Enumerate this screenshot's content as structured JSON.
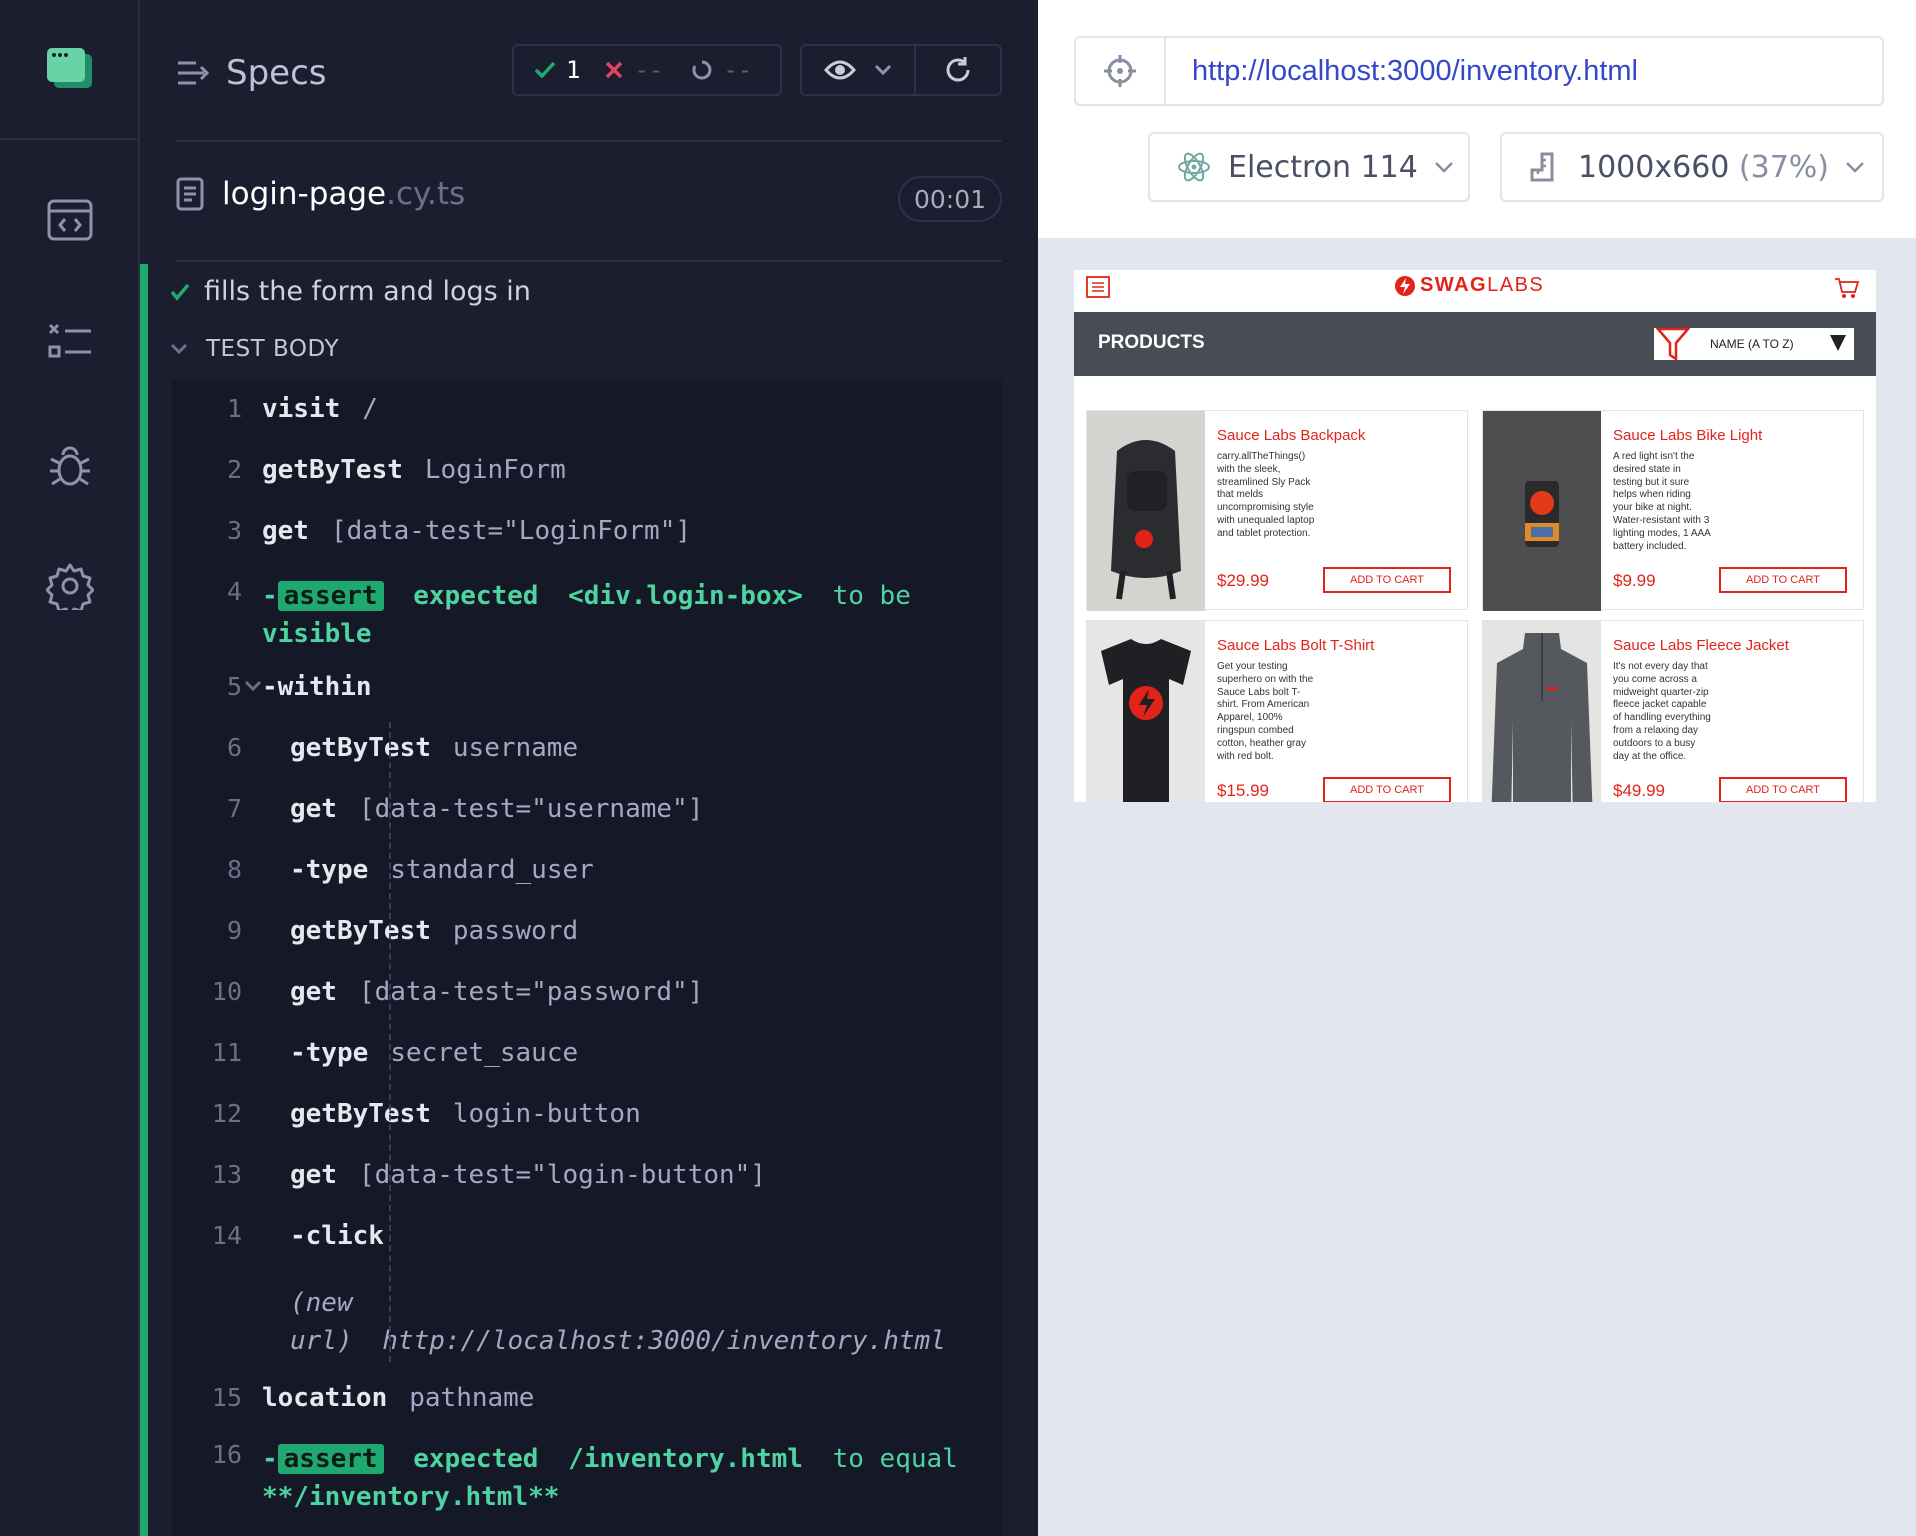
{
  "reporter": {
    "specs_label": "Specs",
    "stats": {
      "passed": "1",
      "failed": "--",
      "pending": "--"
    },
    "spec_file": {
      "name": "login-page",
      "ext": ".cy.ts"
    },
    "duration": "00:01",
    "test_title": "fills the form and logs in",
    "section_label": "TEST BODY",
    "commands": [
      {
        "num": "1",
        "name": "visit",
        "msg": "/"
      },
      {
        "num": "2",
        "name": "getByTest",
        "msg": "LoginForm"
      },
      {
        "num": "3",
        "name": "get",
        "msg": "[data-test=\"LoginForm\"]"
      },
      {
        "num": "4",
        "name": "-assert",
        "msg_parts": [
          "expected",
          "<div.login-box>",
          "to be",
          "visible"
        ]
      },
      {
        "num": "5",
        "name": "-within",
        "msg": ""
      },
      {
        "num": "6",
        "name": "getByTest",
        "msg": "username"
      },
      {
        "num": "7",
        "name": "get",
        "msg": "[data-test=\"username\"]"
      },
      {
        "num": "8",
        "name": "-type",
        "msg": "standard_user"
      },
      {
        "num": "9",
        "name": "getByTest",
        "msg": "password"
      },
      {
        "num": "10",
        "name": "get",
        "msg": "[data-test=\"password\"]"
      },
      {
        "num": "11",
        "name": "-type",
        "msg": "secret_sauce"
      },
      {
        "num": "12",
        "name": "getByTest",
        "msg": "login-button"
      },
      {
        "num": "13",
        "name": "get",
        "msg": "[data-test=\"login-button\"]"
      },
      {
        "num": "14",
        "name": "-click",
        "msg": ""
      },
      {
        "num": "15",
        "name": "location",
        "msg": "pathname"
      },
      {
        "num": "16",
        "name": "-assert",
        "msg_parts": [
          "expected",
          "/inventory.html",
          "to equal",
          "**/inventory.html**"
        ]
      }
    ],
    "new_url": {
      "label_1": "(new",
      "label_2": "url)",
      "url": "http://localhost:3000/inventory.html"
    }
  },
  "aut": {
    "url": "http://localhost:3000/inventory.html",
    "browser": "Electron 114",
    "viewport_size": "1000x660",
    "viewport_scale": "(37%)",
    "app": {
      "logo_a": "SWAG",
      "logo_b": "LABS",
      "section": "PRODUCTS",
      "sort": "NAME (A TO Z)",
      "products": [
        {
          "name": "Sauce Labs Backpack",
          "desc": "carry.allTheThings() with the sleek, streamlined Sly Pack that melds uncompromising style with unequaled laptop and tablet protection.",
          "price": "$29.99",
          "button": "ADD TO CART"
        },
        {
          "name": "Sauce Labs Bike Light",
          "desc": "A red light isn't the desired state in testing but it sure helps when riding your bike at night. Water-resistant with 3 lighting modes, 1 AAA battery included.",
          "price": "$9.99",
          "button": "ADD TO CART"
        },
        {
          "name": "Sauce Labs Bolt T-Shirt",
          "desc": "Get your testing superhero on with the Sauce Labs bolt T-shirt. From American Apparel, 100% ringspun combed cotton, heather gray with red bolt.",
          "price": "$15.99",
          "button": "ADD TO CART"
        },
        {
          "name": "Sauce Labs Fleece Jacket",
          "desc": "It's not every day that you come across a midweight quarter-zip fleece jacket capable of handling everything from a relaxing day outdoors to a busy day at the office.",
          "price": "$49.99",
          "button": "ADD TO CART"
        }
      ]
    }
  },
  "colors": {
    "pass": "#1fa971",
    "fail": "#e0445a",
    "brand_red": "#e2231a",
    "url_blue": "#3548c8"
  },
  "icons": [
    "cypress-logo-icon",
    "browser-code-icon",
    "test-list-icon",
    "bug-icon",
    "gear-icon",
    "specs-list-icon",
    "check-icon",
    "x-icon",
    "spinner-icon",
    "eye-icon",
    "chevron-down-icon",
    "reload-icon",
    "file-icon",
    "chevron-down-icon",
    "crosshair-icon",
    "electron-icon",
    "ruler-icon",
    "menu-icon",
    "cart-icon",
    "filter-icon"
  ]
}
